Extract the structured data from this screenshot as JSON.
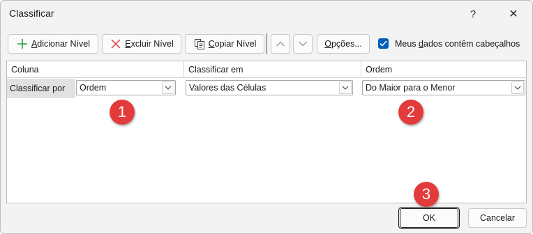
{
  "window": {
    "title": "Classificar",
    "help_glyph": "?",
    "close_glyph": "✕"
  },
  "toolbar": {
    "add_level": {
      "accel": "A",
      "rest": "dicionar Nível"
    },
    "delete_level": {
      "accel": "E",
      "rest": "xcluir Nível"
    },
    "copy_level": {
      "accel": "C",
      "rest": "opiar Nível"
    },
    "options": {
      "accel": "O",
      "rest": "pções..."
    },
    "move_up_icon": "chevron-up-icon",
    "move_down_icon": "chevron-down-icon",
    "headers_checkbox": {
      "checked": true,
      "pre": "Meus ",
      "accel": "d",
      "post": "ados contêm cabeçalhos"
    }
  },
  "grid": {
    "headers": [
      "Coluna",
      "Classificar em",
      "Ordem"
    ],
    "rows": [
      {
        "label": "Classificar por",
        "column": "Ordem",
        "sort_on": "Valores das Células",
        "order": "Do Maior para o Menor"
      }
    ]
  },
  "annotations": [
    "1",
    "2",
    "3"
  ],
  "footer": {
    "ok": "OK",
    "cancel": "Cancelar"
  },
  "colors": {
    "accent": "#005fb8",
    "badge": "#e33b3b",
    "add_icon": "#2e9e3a",
    "delete_icon": "#d83b3b"
  }
}
